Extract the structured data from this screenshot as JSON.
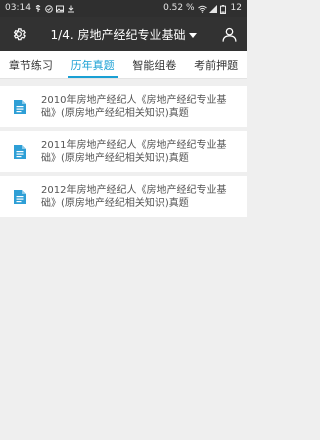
{
  "status_bar": {
    "time": "03:14",
    "data_rate": "0.52 %",
    "battery": "12"
  },
  "header": {
    "title": "1/4. 房地产经纪专业基础"
  },
  "tabs": [
    {
      "label": "章节练习",
      "active": false
    },
    {
      "label": "历年真题",
      "active": true
    },
    {
      "label": "智能组卷",
      "active": false
    },
    {
      "label": "考前押题",
      "active": false
    }
  ],
  "items": [
    {
      "title": "2010年房地产经纪人《房地产经纪专业基础》(原房地产经纪相关知识)真题"
    },
    {
      "title": "2011年房地产经纪人《房地产经纪专业基础》(原房地产经纪相关知识)真题"
    },
    {
      "title": "2012年房地产经纪人《房地产经纪专业基础》(原房地产经纪相关知识)真题"
    }
  ],
  "colors": {
    "accent": "#1aa0d4",
    "header_bg": "#323232",
    "icon_blue": "#2e9fd6"
  }
}
